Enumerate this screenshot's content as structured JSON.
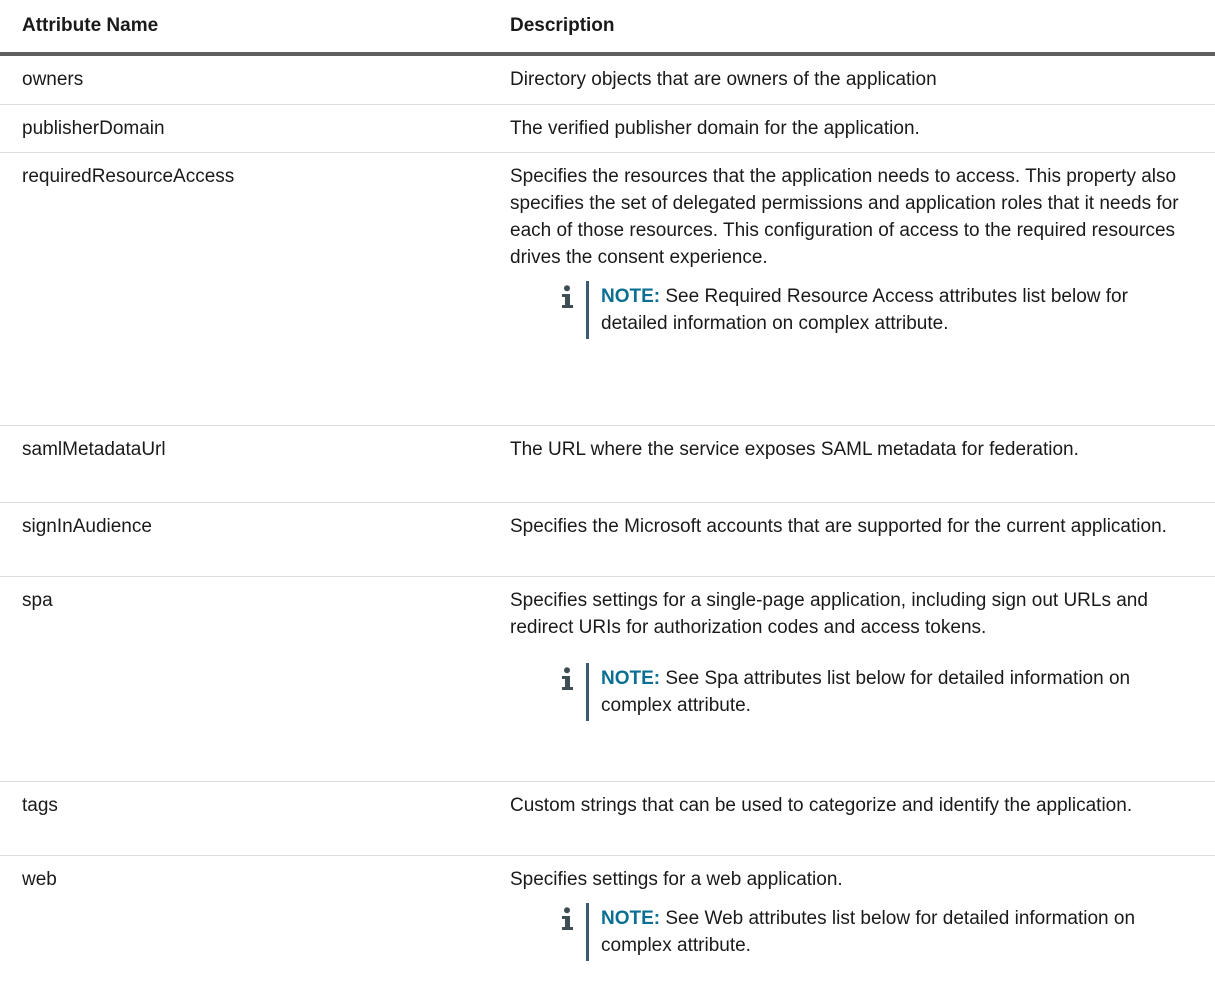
{
  "table": {
    "headers": {
      "attribute_name": "Attribute Name",
      "description": "Description"
    },
    "rows": [
      {
        "name": "owners",
        "description": "Directory objects that are owners of the application"
      },
      {
        "name": "publisherDomain",
        "description": "The verified publisher domain for the application."
      },
      {
        "name": "requiredResourceAccess",
        "description": "Specifies the resources that the application needs to access. This property also specifies the set of delegated permissions and application roles that it needs for each of those resources. This configuration of access to the required resources drives the consent experience.",
        "note_label": "NOTE:",
        "note_text": " See Required Resource Access attributes list below for detailed information on complex attribute."
      },
      {
        "name": "samlMetadataUrl",
        "description": "The URL where the service exposes SAML metadata for federation."
      },
      {
        "name": "signInAudience",
        "description": "Specifies the Microsoft accounts that are supported for the current application."
      },
      {
        "name": "spa",
        "description": "Specifies settings for a single-page application, including sign out URLs and redirect URIs for authorization codes and access tokens.",
        "note_label": "NOTE:",
        "note_text": " See Spa attributes list below for detailed information on complex attribute."
      },
      {
        "name": "tags",
        "description": "Custom strings that can be used to categorize and identify the application."
      },
      {
        "name": "web",
        "description": "Specifies settings for a web application.",
        "note_label": "NOTE:",
        "note_text": " See Web attributes list below for detailed information on complex attribute."
      }
    ]
  },
  "icons": {
    "note": "info-icon"
  },
  "colors": {
    "note_label": "#0b6f94",
    "header_rule": "#5f5f5f",
    "row_rule": "#dcdcdc",
    "note_bar": "#3a5a6e",
    "info_icon": "#3f4d55"
  }
}
